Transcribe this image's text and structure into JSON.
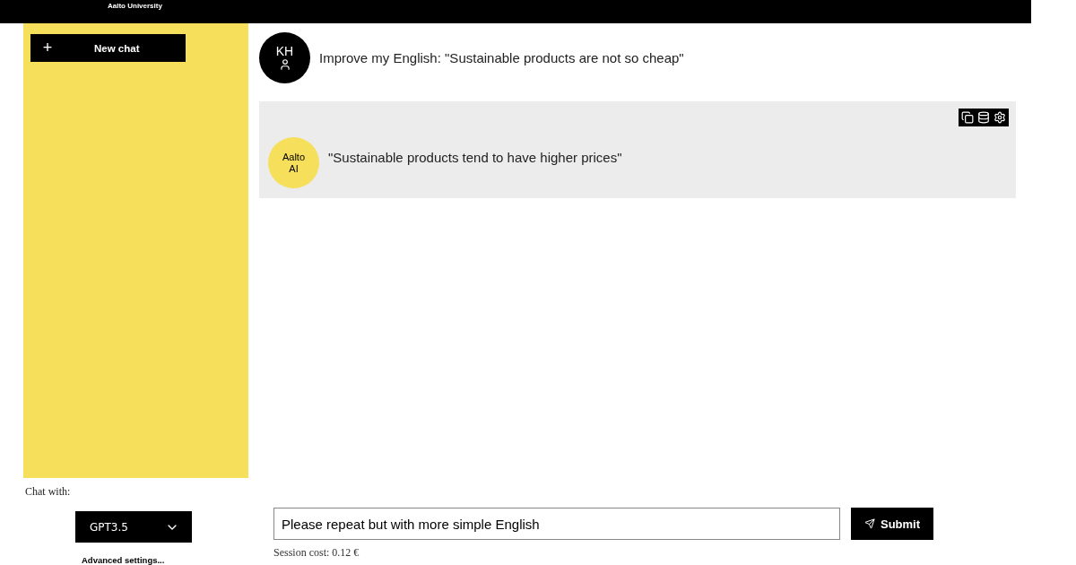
{
  "header": {
    "brand": "Aalto University"
  },
  "sidebar": {
    "new_chat": {
      "icon": "+",
      "label": "New chat"
    },
    "chat_with_label": "Chat with:",
    "model": "GPT3.5",
    "advanced": "Advanced settings..."
  },
  "messages": [
    {
      "kind": "user",
      "avatar": "KH",
      "text": "Improve my English: \"Sustainable products are not so cheap\""
    },
    {
      "kind": "assistant",
      "avatar": "Aalto AI",
      "text": "\"Sustainable products tend to have higher prices\""
    }
  ],
  "composer": {
    "value": "Please repeat but with more simple English",
    "submit": "Submit",
    "cost": "Session cost: 0.12 €"
  }
}
